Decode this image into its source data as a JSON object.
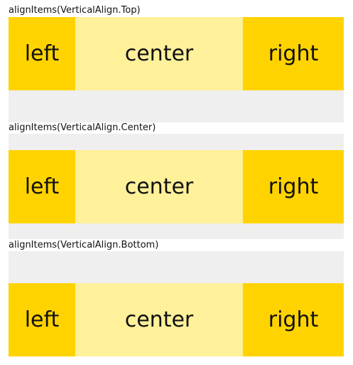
{
  "colors": {
    "row_background": "#efefef",
    "side_cell": "#ffd300",
    "center_cell": "#fff09a",
    "text": "#111111"
  },
  "sections": [
    {
      "label": "alignItems(VerticalAlign.Top)",
      "vertical_align": "top",
      "cells": {
        "left": "left",
        "center": "center",
        "right": "right"
      }
    },
    {
      "label": "alignItems(VerticalAlign.Center)",
      "vertical_align": "center",
      "cells": {
        "left": "left",
        "center": "center",
        "right": "right"
      }
    },
    {
      "label": "alignItems(VerticalAlign.Bottom)",
      "vertical_align": "bottom",
      "cells": {
        "left": "left",
        "center": "center",
        "right": "right"
      }
    }
  ]
}
